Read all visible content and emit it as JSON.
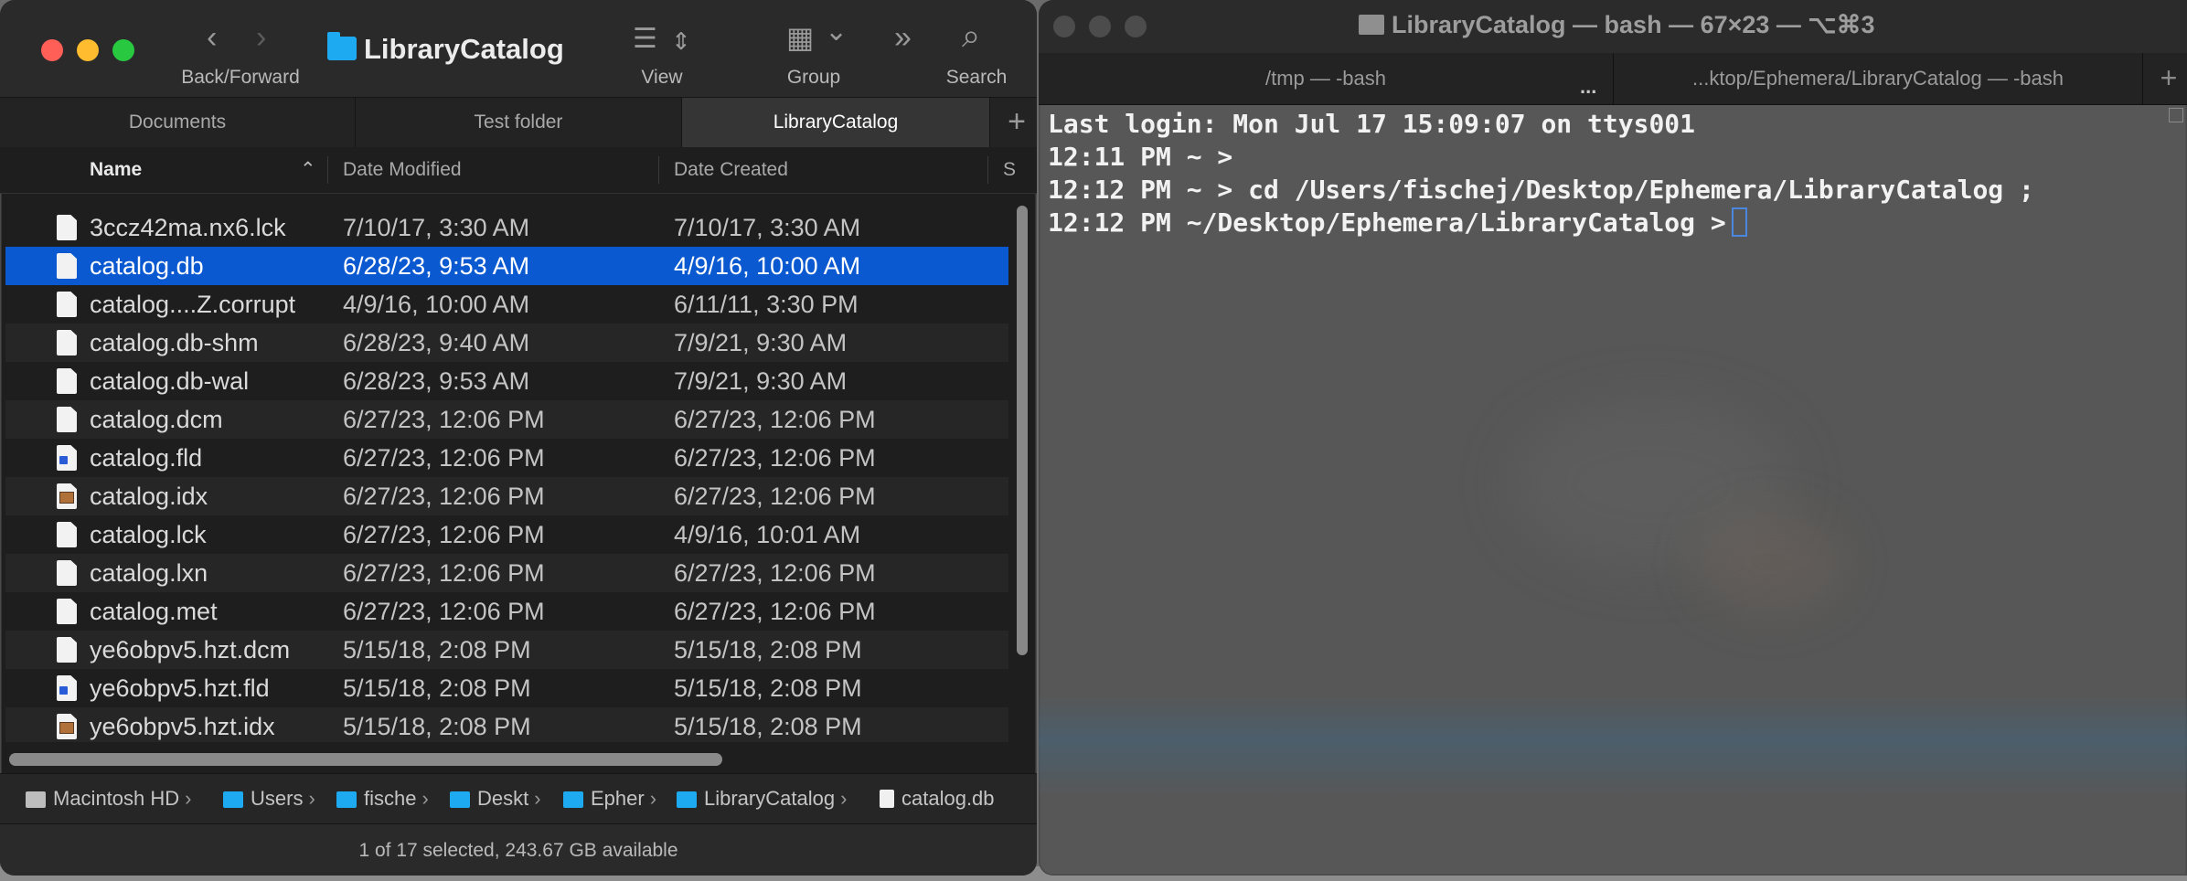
{
  "finder": {
    "title": "LibraryCatalog",
    "toolbar": {
      "back_forward_label": "Back/Forward",
      "view_label": "View",
      "group_label": "Group",
      "search_label": "Search",
      "back_glyph": "‹",
      "forward_glyph": "›",
      "view_glyph": "☰",
      "view_updown_glyph": "⇕",
      "group_glyph": "▦",
      "group_chevron_glyph": "⌄",
      "more_glyph": "»",
      "search_glyph": "⌕"
    },
    "tabs": [
      {
        "label": "Documents"
      },
      {
        "label": "Test folder"
      },
      {
        "label": "LibraryCatalog"
      }
    ],
    "add_tab_glyph": "+",
    "columns": {
      "name": "Name",
      "sort_glyph": "⌃",
      "date_modified": "Date Modified",
      "date_created": "Date Created",
      "extra": "S"
    },
    "files": [
      {
        "name": "3ccz42ma.nx6.lck",
        "modified": "7/10/17, 3:30 AM",
        "created": "7/10/17, 3:30 AM",
        "icon": "doc-icon"
      },
      {
        "name": "catalog.db",
        "modified": "6/28/23, 9:53 AM",
        "created": "4/9/16, 10:00 AM",
        "icon": "doc-icon",
        "selected": true
      },
      {
        "name": "catalog....Z.corrupt",
        "modified": "4/9/16, 10:00 AM",
        "created": "6/11/11, 3:30 PM",
        "icon": "doc-icon"
      },
      {
        "name": "catalog.db-shm",
        "modified": "6/28/23, 9:40 AM",
        "created": "7/9/21, 9:30 AM",
        "icon": "doc-icon"
      },
      {
        "name": "catalog.db-wal",
        "modified": "6/28/23, 9:53 AM",
        "created": "7/9/21, 9:30 AM",
        "icon": "doc-icon"
      },
      {
        "name": "catalog.dcm",
        "modified": "6/27/23, 12:06 PM",
        "created": "6/27/23, 12:06 PM",
        "icon": "doc-icon"
      },
      {
        "name": "catalog.fld",
        "modified": "6/27/23, 12:06 PM",
        "created": "6/27/23, 12:06 PM",
        "icon": "word-doc-icon"
      },
      {
        "name": "catalog.idx",
        "modified": "6/27/23, 12:06 PM",
        "created": "6/27/23, 12:06 PM",
        "icon": "image-doc-icon"
      },
      {
        "name": "catalog.lck",
        "modified": "6/27/23, 12:06 PM",
        "created": "4/9/16, 10:01 AM",
        "icon": "doc-icon"
      },
      {
        "name": "catalog.lxn",
        "modified": "6/27/23, 12:06 PM",
        "created": "6/27/23, 12:06 PM",
        "icon": "doc-icon"
      },
      {
        "name": "catalog.met",
        "modified": "6/27/23, 12:06 PM",
        "created": "6/27/23, 12:06 PM",
        "icon": "doc-icon"
      },
      {
        "name": "ye6obpv5.hzt.dcm",
        "modified": "5/15/18, 2:08 PM",
        "created": "5/15/18, 2:08 PM",
        "icon": "doc-icon"
      },
      {
        "name": "ye6obpv5.hzt.fld",
        "modified": "5/15/18, 2:08 PM",
        "created": "5/15/18, 2:08 PM",
        "icon": "word-doc-icon"
      },
      {
        "name": "ye6obpv5.hzt.idx",
        "modified": "5/15/18, 2:08 PM",
        "created": "5/15/18, 2:08 PM",
        "icon": "image-doc-icon"
      }
    ],
    "path": [
      {
        "label": "Macintosh HD",
        "icon": "disk-icon"
      },
      {
        "label": "Users",
        "icon": "folder-icon"
      },
      {
        "label": "fische",
        "icon": "folder-icon"
      },
      {
        "label": "Deskt",
        "icon": "folder-icon"
      },
      {
        "label": "Epher",
        "icon": "folder-icon"
      },
      {
        "label": "LibraryCatalog",
        "icon": "folder-icon"
      },
      {
        "label": "catalog.db",
        "icon": "doc-icon"
      }
    ],
    "path_separator": "›",
    "status": "1 of 17 selected, 243.67 GB available"
  },
  "terminal": {
    "title": "LibraryCatalog — bash — 67×23 — ⌥⌘3",
    "tabs": [
      {
        "label": "/tmp — -bash"
      },
      {
        "label": "...ktop/Ephemera/LibraryCatalog — -bash"
      }
    ],
    "tab_overflow": "...",
    "add_tab_glyph": "+",
    "lines": [
      "Last login: Mon Jul 17 15:09:07 on ttys001",
      "12:11 PM ~ >",
      "12:12 PM ~ > cd /Users/fischej/Desktop/Ephemera/LibraryCatalog ;",
      "12:12 PM ~/Desktop/Ephemera/LibraryCatalog >"
    ]
  },
  "colors": {
    "selection": "#0a59d1",
    "folder": "#1eaaf1",
    "close": "#ff5f57",
    "minimize": "#febc2e",
    "maximize": "#28c840",
    "cursor": "#4a88e0"
  }
}
